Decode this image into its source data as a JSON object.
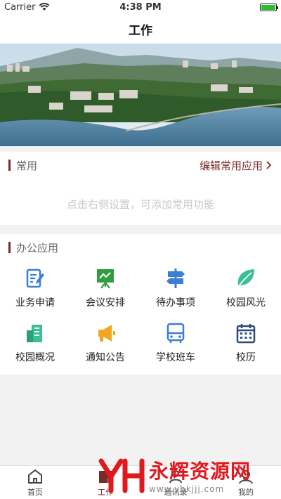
{
  "status_bar": {
    "carrier": "Carrier",
    "time": "4:38 PM",
    "battery_level": 1.0
  },
  "nav": {
    "title": "工作"
  },
  "common": {
    "title": "常用",
    "edit_label": "编辑常用应用",
    "hint": "点击右侧设置，可添加常用功能"
  },
  "office": {
    "title": "办公应用",
    "apps": [
      {
        "label": "业务申请",
        "icon": "form-edit-icon",
        "color": "#3a7fd5"
      },
      {
        "label": "会议安排",
        "icon": "presentation-icon",
        "color": "#2e9e3e"
      },
      {
        "label": "待办事项",
        "icon": "signpost-icon",
        "color": "#3a7fd5"
      },
      {
        "label": "校园风光",
        "icon": "leaf-icon",
        "color": "#3bbf96"
      },
      {
        "label": "校园概况",
        "icon": "building-icon",
        "color": "#3bbf96"
      },
      {
        "label": "通知公告",
        "icon": "megaphone-icon",
        "color": "#f0a820"
      },
      {
        "label": "学校班车",
        "icon": "bus-icon",
        "color": "#3a7fd5"
      },
      {
        "label": "校历",
        "icon": "calendar-icon",
        "color": "#2d4a7a"
      }
    ]
  },
  "tabs": [
    {
      "label": "首页",
      "icon": "home-icon",
      "active": false
    },
    {
      "label": "工作",
      "icon": "work-icon",
      "active": true
    },
    {
      "label": "通讯录",
      "icon": "contacts-icon",
      "active": false
    },
    {
      "label": "我的",
      "icon": "profile-icon",
      "active": false
    }
  ],
  "watermark": {
    "text": "永辉资源网",
    "url": "www.yhkjjj.com"
  }
}
